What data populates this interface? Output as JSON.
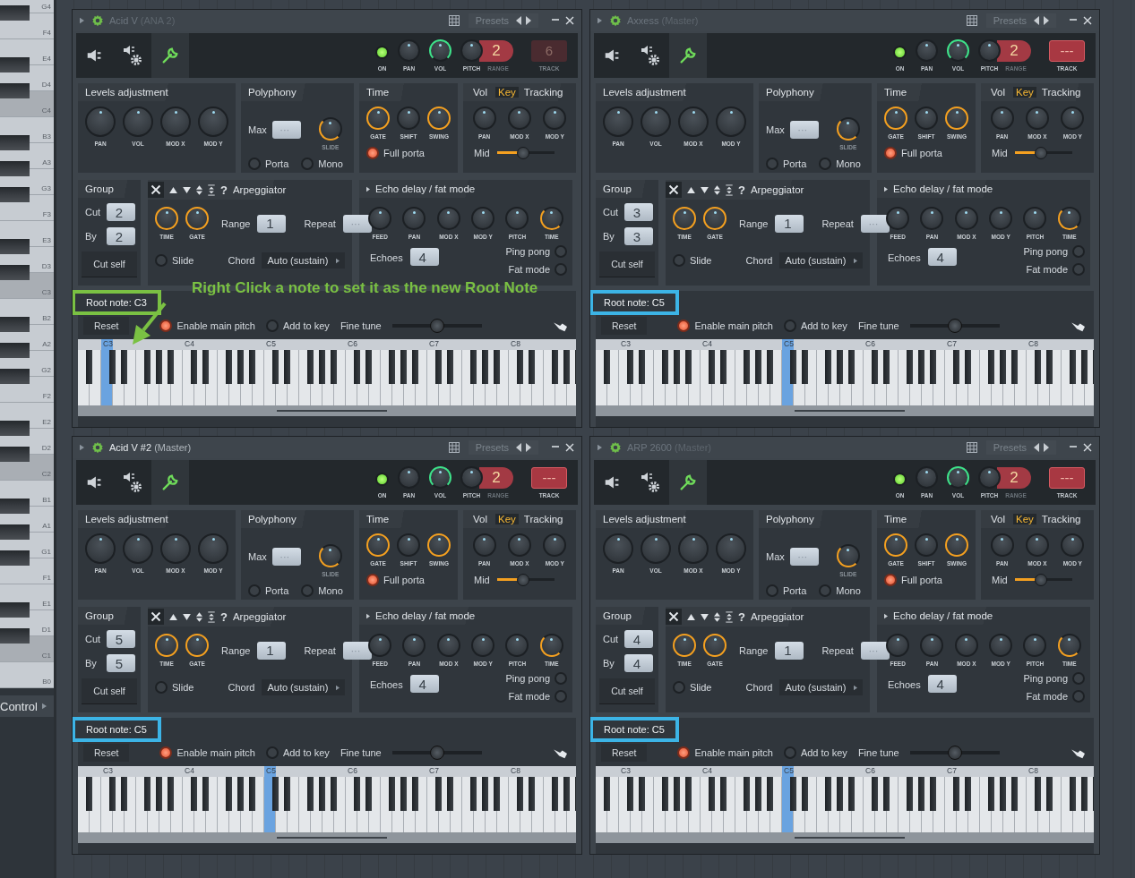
{
  "piano_roll": {
    "notes": [
      "G4",
      "F4",
      "E4",
      "D4",
      "C4",
      "B3",
      "A3",
      "G3",
      "F3",
      "E3",
      "D3",
      "C3",
      "B2",
      "A2",
      "G2",
      "F2",
      "E2",
      "D2",
      "C2",
      "B1",
      "A1",
      "G1",
      "F1",
      "E1",
      "D1",
      "C1",
      "B0"
    ],
    "control": "Control"
  },
  "annotation": {
    "text": "Right Click  a note to set it as the new Root Note"
  },
  "panels": [
    {
      "title": "Acid V",
      "subtitle": "(ANA 2)",
      "focused": false,
      "presets": "Presets",
      "tabs": [
        {
          "kind": "speaker",
          "selected": false
        },
        {
          "kind": "speaker-gear",
          "selected": false
        },
        {
          "kind": "wrench",
          "selected": true
        }
      ],
      "header": {
        "on": "ON",
        "knobs": [
          {
            "label": "PAN",
            "arc": false
          },
          {
            "label": "VOL",
            "arc": true
          },
          {
            "label": "PITCH",
            "arc": false
          }
        ],
        "range": "2",
        "range_label": "RANGE",
        "track": "6",
        "track_label": "TRACK",
        "track_on": false
      },
      "levels": {
        "title": "Levels adjustment",
        "knobs": [
          {
            "label": "PAN",
            "arc": false
          },
          {
            "label": "VOL",
            "arc": false
          },
          {
            "label": "MOD X",
            "arc": false
          },
          {
            "label": "MOD Y",
            "arc": false
          }
        ]
      },
      "polyphony": {
        "title": "Polyphony",
        "max_label": "Max",
        "max": "···",
        "slide": "SLIDE",
        "porta": {
          "label": "Porta",
          "checked": false
        },
        "mono": {
          "label": "Mono",
          "checked": false
        }
      },
      "time": {
        "title": "Time",
        "knobs": [
          {
            "label": "GATE",
            "arc": true
          },
          {
            "label": "SHIFT",
            "arc": false
          },
          {
            "label": "SWING",
            "arc": true
          }
        ],
        "full_porta": {
          "label": "Full porta",
          "checked": true
        }
      },
      "tracking": {
        "tabs": [
          {
            "label": "Vol",
            "selected": false
          },
          {
            "label": "Key",
            "selected": true
          }
        ],
        "title": "Tracking",
        "knobs": [
          {
            "label": "PAN",
            "arc": false
          },
          {
            "label": "MOD X",
            "arc": false
          },
          {
            "label": "MOD Y",
            "arc": false
          }
        ],
        "mid": "Mid",
        "level": 0.45
      },
      "group": {
        "title": "Group",
        "cut_label": "Cut",
        "cut": "2",
        "by_label": "By",
        "by": "2",
        "cut_self": "Cut self"
      },
      "arp": {
        "help": "?",
        "title": "Arpeggiator",
        "knobs": [
          {
            "label": "TIME",
            "arc": true
          },
          {
            "label": "GATE",
            "arc": true
          }
        ],
        "range_label": "Range",
        "range": "1",
        "repeat_label": "Repeat",
        "repeat": "···",
        "slide": {
          "label": "Slide",
          "checked": false
        },
        "chord_label": "Chord",
        "chord": "Auto (sustain)"
      },
      "echo": {
        "title": "Echo delay / fat mode",
        "knobs": [
          {
            "label": "FEED",
            "arc": false
          },
          {
            "label": "PAN",
            "arc": false
          },
          {
            "label": "MOD X",
            "arc": false
          },
          {
            "label": "MOD Y",
            "arc": false
          },
          {
            "label": "PITCH",
            "arc": false
          },
          {
            "label": "TIME",
            "arc": true
          }
        ],
        "echoes_label": "Echoes",
        "echoes": "4",
        "ping_pong": {
          "label": "Ping pong",
          "checked": false
        },
        "fat_mode": {
          "label": "Fat mode",
          "checked": false
        }
      },
      "root": {
        "label": "Root note: C3",
        "color": "#7ac143"
      },
      "reset": "Reset",
      "main_pitch": {
        "label": "Enable main pitch",
        "checked": true
      },
      "add_to_key": {
        "label": "Add to key",
        "checked": false
      },
      "fine_tune": {
        "label": "Fine tune",
        "level": 0.5
      },
      "octaves": [
        {
          "label": "C3",
          "root": true
        },
        {
          "label": "C4",
          "root": false
        },
        {
          "label": "C5",
          "root": false
        },
        {
          "label": "C6",
          "root": false
        },
        {
          "label": "C7",
          "root": false
        },
        {
          "label": "C8",
          "root": false
        }
      ]
    },
    {
      "title": "Axxess",
      "subtitle": "(Master)",
      "focused": false,
      "presets": "Presets",
      "tabs": [
        {
          "kind": "speaker",
          "selected": false
        },
        {
          "kind": "speaker-gear",
          "selected": false
        },
        {
          "kind": "wrench",
          "selected": true
        }
      ],
      "header": {
        "on": "ON",
        "knobs": [
          {
            "label": "PAN",
            "arc": false
          },
          {
            "label": "VOL",
            "arc": true
          },
          {
            "label": "PITCH",
            "arc": false
          }
        ],
        "range": "2",
        "range_label": "RANGE",
        "track": "---",
        "track_label": "TRACK",
        "track_on": true
      },
      "levels": {
        "title": "Levels adjustment",
        "knobs": [
          {
            "label": "PAN",
            "arc": false
          },
          {
            "label": "VOL",
            "arc": false
          },
          {
            "label": "MOD X",
            "arc": false
          },
          {
            "label": "MOD Y",
            "arc": false
          }
        ]
      },
      "polyphony": {
        "title": "Polyphony",
        "max_label": "Max",
        "max": "···",
        "slide": "SLIDE",
        "porta": {
          "label": "Porta",
          "checked": false
        },
        "mono": {
          "label": "Mono",
          "checked": false
        }
      },
      "time": {
        "title": "Time",
        "knobs": [
          {
            "label": "GATE",
            "arc": true
          },
          {
            "label": "SHIFT",
            "arc": false
          },
          {
            "label": "SWING",
            "arc": true
          }
        ],
        "full_porta": {
          "label": "Full porta",
          "checked": true
        }
      },
      "tracking": {
        "tabs": [
          {
            "label": "Vol",
            "selected": false
          },
          {
            "label": "Key",
            "selected": true
          }
        ],
        "title": "Tracking",
        "knobs": [
          {
            "label": "PAN",
            "arc": false
          },
          {
            "label": "MOD X",
            "arc": false
          },
          {
            "label": "MOD Y",
            "arc": false
          }
        ],
        "mid": "Mid",
        "level": 0.45
      },
      "group": {
        "title": "Group",
        "cut_label": "Cut",
        "cut": "3",
        "by_label": "By",
        "by": "3",
        "cut_self": "Cut self"
      },
      "arp": {
        "help": "?",
        "title": "Arpeggiator",
        "knobs": [
          {
            "label": "TIME",
            "arc": true
          },
          {
            "label": "GATE",
            "arc": true
          }
        ],
        "range_label": "Range",
        "range": "1",
        "repeat_label": "Repeat",
        "repeat": "···",
        "slide": {
          "label": "Slide",
          "checked": false
        },
        "chord_label": "Chord",
        "chord": "Auto (sustain)"
      },
      "echo": {
        "title": "Echo delay / fat mode",
        "knobs": [
          {
            "label": "FEED",
            "arc": false
          },
          {
            "label": "PAN",
            "arc": false
          },
          {
            "label": "MOD X",
            "arc": false
          },
          {
            "label": "MOD Y",
            "arc": false
          },
          {
            "label": "PITCH",
            "arc": false
          },
          {
            "label": "TIME",
            "arc": true
          }
        ],
        "echoes_label": "Echoes",
        "echoes": "4",
        "ping_pong": {
          "label": "Ping pong",
          "checked": false
        },
        "fat_mode": {
          "label": "Fat mode",
          "checked": false
        }
      },
      "root": {
        "label": "Root note: C5",
        "color": "#3cb4e6"
      },
      "reset": "Reset",
      "main_pitch": {
        "label": "Enable main pitch",
        "checked": true
      },
      "add_to_key": {
        "label": "Add to key",
        "checked": false
      },
      "fine_tune": {
        "label": "Fine tune",
        "level": 0.5
      },
      "octaves": [
        {
          "label": "C3",
          "root": false
        },
        {
          "label": "C4",
          "root": false
        },
        {
          "label": "C5",
          "root": true
        },
        {
          "label": "C6",
          "root": false
        },
        {
          "label": "C7",
          "root": false
        },
        {
          "label": "C8",
          "root": false
        }
      ]
    },
    {
      "title": "Acid V #2",
      "subtitle": "(Master)",
      "focused": true,
      "presets": "Presets",
      "tabs": [
        {
          "kind": "speaker",
          "selected": false
        },
        {
          "kind": "speaker-gear",
          "selected": false
        },
        {
          "kind": "wrench",
          "selected": true
        }
      ],
      "header": {
        "on": "ON",
        "knobs": [
          {
            "label": "PAN",
            "arc": false
          },
          {
            "label": "VOL",
            "arc": true
          },
          {
            "label": "PITCH",
            "arc": false
          }
        ],
        "range": "2",
        "range_label": "RANGE",
        "track": "---",
        "track_label": "TRACK",
        "track_on": true
      },
      "levels": {
        "title": "Levels adjustment",
        "knobs": [
          {
            "label": "PAN",
            "arc": false
          },
          {
            "label": "VOL",
            "arc": false
          },
          {
            "label": "MOD X",
            "arc": false
          },
          {
            "label": "MOD Y",
            "arc": false
          }
        ]
      },
      "polyphony": {
        "title": "Polyphony",
        "max_label": "Max",
        "max": "···",
        "slide": "SLIDE",
        "porta": {
          "label": "Porta",
          "checked": false
        },
        "mono": {
          "label": "Mono",
          "checked": false
        }
      },
      "time": {
        "title": "Time",
        "knobs": [
          {
            "label": "GATE",
            "arc": true
          },
          {
            "label": "SHIFT",
            "arc": false
          },
          {
            "label": "SWING",
            "arc": true
          }
        ],
        "full_porta": {
          "label": "Full porta",
          "checked": true
        }
      },
      "tracking": {
        "tabs": [
          {
            "label": "Vol",
            "selected": false
          },
          {
            "label": "Key",
            "selected": true
          }
        ],
        "title": "Tracking",
        "knobs": [
          {
            "label": "PAN",
            "arc": false
          },
          {
            "label": "MOD X",
            "arc": false
          },
          {
            "label": "MOD Y",
            "arc": false
          }
        ],
        "mid": "Mid",
        "level": 0.45
      },
      "group": {
        "title": "Group",
        "cut_label": "Cut",
        "cut": "5",
        "by_label": "By",
        "by": "5",
        "cut_self": "Cut self"
      },
      "arp": {
        "help": "?",
        "title": "Arpeggiator",
        "knobs": [
          {
            "label": "TIME",
            "arc": true
          },
          {
            "label": "GATE",
            "arc": true
          }
        ],
        "range_label": "Range",
        "range": "1",
        "repeat_label": "Repeat",
        "repeat": "···",
        "slide": {
          "label": "Slide",
          "checked": false
        },
        "chord_label": "Chord",
        "chord": "Auto (sustain)"
      },
      "echo": {
        "title": "Echo delay / fat mode",
        "knobs": [
          {
            "label": "FEED",
            "arc": false
          },
          {
            "label": "PAN",
            "arc": false
          },
          {
            "label": "MOD X",
            "arc": false
          },
          {
            "label": "MOD Y",
            "arc": false
          },
          {
            "label": "PITCH",
            "arc": false
          },
          {
            "label": "TIME",
            "arc": true
          }
        ],
        "echoes_label": "Echoes",
        "echoes": "4",
        "ping_pong": {
          "label": "Ping pong",
          "checked": false
        },
        "fat_mode": {
          "label": "Fat mode",
          "checked": false
        }
      },
      "root": {
        "label": "Root note: C5",
        "color": "#3cb4e6"
      },
      "reset": "Reset",
      "main_pitch": {
        "label": "Enable main pitch",
        "checked": true
      },
      "add_to_key": {
        "label": "Add to key",
        "checked": false
      },
      "fine_tune": {
        "label": "Fine tune",
        "level": 0.5
      },
      "octaves": [
        {
          "label": "C3",
          "root": false
        },
        {
          "label": "C4",
          "root": false
        },
        {
          "label": "C5",
          "root": true
        },
        {
          "label": "C6",
          "root": false
        },
        {
          "label": "C7",
          "root": false
        },
        {
          "label": "C8",
          "root": false
        }
      ]
    },
    {
      "title": "ARP 2600",
      "subtitle": "(Master)",
      "focused": false,
      "presets": "Presets",
      "tabs": [
        {
          "kind": "speaker",
          "selected": false
        },
        {
          "kind": "speaker-gear",
          "selected": false
        },
        {
          "kind": "wrench",
          "selected": true
        }
      ],
      "header": {
        "on": "ON",
        "knobs": [
          {
            "label": "PAN",
            "arc": false
          },
          {
            "label": "VOL",
            "arc": true
          },
          {
            "label": "PITCH",
            "arc": false
          }
        ],
        "range": "2",
        "range_label": "RANGE",
        "track": "---",
        "track_label": "TRACK",
        "track_on": true
      },
      "levels": {
        "title": "Levels adjustment",
        "knobs": [
          {
            "label": "PAN",
            "arc": false
          },
          {
            "label": "VOL",
            "arc": false
          },
          {
            "label": "MOD X",
            "arc": false
          },
          {
            "label": "MOD Y",
            "arc": false
          }
        ]
      },
      "polyphony": {
        "title": "Polyphony",
        "max_label": "Max",
        "max": "···",
        "slide": "SLIDE",
        "porta": {
          "label": "Porta",
          "checked": false
        },
        "mono": {
          "label": "Mono",
          "checked": false
        }
      },
      "time": {
        "title": "Time",
        "knobs": [
          {
            "label": "GATE",
            "arc": true
          },
          {
            "label": "SHIFT",
            "arc": false
          },
          {
            "label": "SWING",
            "arc": true
          }
        ],
        "full_porta": {
          "label": "Full porta",
          "checked": true
        }
      },
      "tracking": {
        "tabs": [
          {
            "label": "Vol",
            "selected": false
          },
          {
            "label": "Key",
            "selected": true
          }
        ],
        "title": "Tracking",
        "knobs": [
          {
            "label": "PAN",
            "arc": false
          },
          {
            "label": "MOD X",
            "arc": false
          },
          {
            "label": "MOD Y",
            "arc": false
          }
        ],
        "mid": "Mid",
        "level": 0.45
      },
      "group": {
        "title": "Group",
        "cut_label": "Cut",
        "cut": "4",
        "by_label": "By",
        "by": "4",
        "cut_self": "Cut self"
      },
      "arp": {
        "help": "?",
        "title": "Arpeggiator",
        "knobs": [
          {
            "label": "TIME",
            "arc": true
          },
          {
            "label": "GATE",
            "arc": true
          }
        ],
        "range_label": "Range",
        "range": "1",
        "repeat_label": "Repeat",
        "repeat": "···",
        "slide": {
          "label": "Slide",
          "checked": false
        },
        "chord_label": "Chord",
        "chord": "Auto (sustain)"
      },
      "echo": {
        "title": "Echo delay / fat mode",
        "knobs": [
          {
            "label": "FEED",
            "arc": false
          },
          {
            "label": "PAN",
            "arc": false
          },
          {
            "label": "MOD X",
            "arc": false
          },
          {
            "label": "MOD Y",
            "arc": false
          },
          {
            "label": "PITCH",
            "arc": false
          },
          {
            "label": "TIME",
            "arc": true
          }
        ],
        "echoes_label": "Echoes",
        "echoes": "4",
        "ping_pong": {
          "label": "Ping pong",
          "checked": false
        },
        "fat_mode": {
          "label": "Fat mode",
          "checked": false
        }
      },
      "root": {
        "label": "Root note: C5",
        "color": "#3cb4e6"
      },
      "reset": "Reset",
      "main_pitch": {
        "label": "Enable main pitch",
        "checked": true
      },
      "add_to_key": {
        "label": "Add to key",
        "checked": false
      },
      "fine_tune": {
        "label": "Fine tune",
        "level": 0.5
      },
      "octaves": [
        {
          "label": "C3",
          "root": false
        },
        {
          "label": "C4",
          "root": false
        },
        {
          "label": "C5",
          "root": true
        },
        {
          "label": "C6",
          "root": false
        },
        {
          "label": "C7",
          "root": false
        },
        {
          "label": "C8",
          "root": false
        }
      ]
    }
  ]
}
